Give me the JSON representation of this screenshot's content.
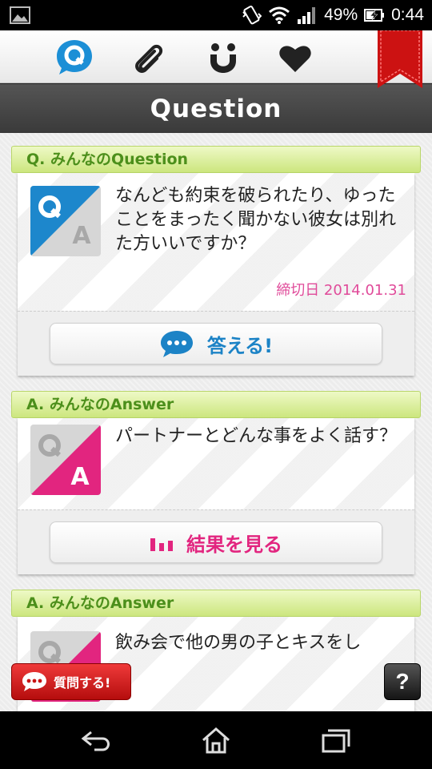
{
  "status_bar": {
    "battery": "49%",
    "time": "0:44",
    "icons": [
      "gallery-icon",
      "vibrate-icon",
      "wifi-icon",
      "signal-icon",
      "battery-charging-icon"
    ]
  },
  "tabs": [
    {
      "name": "question-tab",
      "icon": "q-bubble-icon",
      "active": true
    },
    {
      "name": "clip-tab",
      "icon": "paperclip-icon"
    },
    {
      "name": "smile-tab",
      "icon": "smile-icon"
    },
    {
      "name": "favorite-tab",
      "icon": "heart-icon"
    }
  ],
  "header": {
    "title": "Question"
  },
  "sections": [
    {
      "header": "Q. みんなのQuestion",
      "type": "question",
      "text": "なんども約束を破られたり、ゆったことをまったく聞かない彼女は別れた方いいですか？",
      "deadline": "締切日 2014.01.31",
      "button": "答える!"
    },
    {
      "header": "A. みんなのAnswer",
      "type": "answer",
      "text": "パートナーとどんな事をよく話す？",
      "button": "結果を見る"
    },
    {
      "header": "A. みんなのAnswer",
      "type": "answer",
      "text": "飲み会で他の男の子とキスをし"
    }
  ],
  "ask_button": "質問する!",
  "help_button": "?",
  "colors": {
    "question_blue": "#1c83c6",
    "answer_pink": "#e2257f",
    "header_green": "#4c8f1b",
    "deadline_pink": "#e04b9a",
    "ask_red": "#d42020"
  }
}
